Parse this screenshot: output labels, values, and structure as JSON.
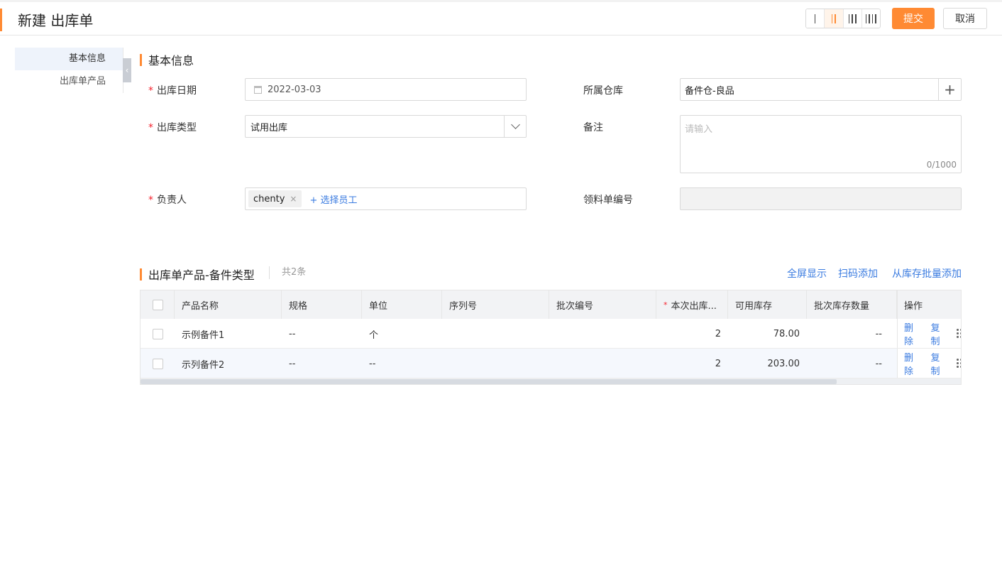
{
  "header": {
    "title": "新建 出库单",
    "layout_options": [
      "1 column",
      "2 columns",
      "3 columns",
      "4 columns"
    ],
    "active_layout": "2 columns",
    "submit_label": "提交",
    "cancel_label": "取消"
  },
  "sidebar": {
    "items": [
      {
        "label": "基本信息",
        "active": true
      },
      {
        "label": "出库单产品",
        "active": false
      }
    ],
    "collapse_icon": "chevron-left-icon"
  },
  "basic_info": {
    "title": "基本信息",
    "outbound_date": {
      "label": "出库日期",
      "value": "2022-03-03",
      "required": true
    },
    "warehouse": {
      "label": "所属仓库",
      "value": "备件仓-良品"
    },
    "outbound_type": {
      "label": "出库类型",
      "value": "试用出库",
      "required": true
    },
    "remark": {
      "label": "备注",
      "placeholder": "请输入",
      "counter": "0/1000"
    },
    "owner": {
      "label": "负责人",
      "tag": "chenty",
      "tag_close": "×",
      "add_label": "+ 选择员工",
      "required": true
    },
    "pick_no": {
      "label": "领料单编号",
      "value": ""
    }
  },
  "products": {
    "title": "出库单产品-备件类型",
    "count": "共2条",
    "actions": [
      "全屏显示",
      "扫码添加",
      "从库存批量添加"
    ],
    "columns": [
      "产品名称",
      "规格",
      "单位",
      "序列号",
      "批次编号",
      "本次出库...",
      "可用库存",
      "批次库存数量",
      "操作"
    ],
    "rows": [
      {
        "name": "示例备件1",
        "spec": "--",
        "unit": "个",
        "serial": "",
        "batch": "",
        "qty": "2",
        "available": "78.00",
        "batch_qty": "--",
        "delete": "删除",
        "copy": "复制"
      },
      {
        "name": "示列备件2",
        "spec": "--",
        "unit": "--",
        "serial": "",
        "batch": "",
        "qty": "2",
        "available": "203.00",
        "batch_qty": "--",
        "delete": "删除",
        "copy": "复制"
      }
    ]
  },
  "colors": {
    "accent": "#ff8a33",
    "link": "#3a7be0",
    "required": "#f5222d"
  }
}
